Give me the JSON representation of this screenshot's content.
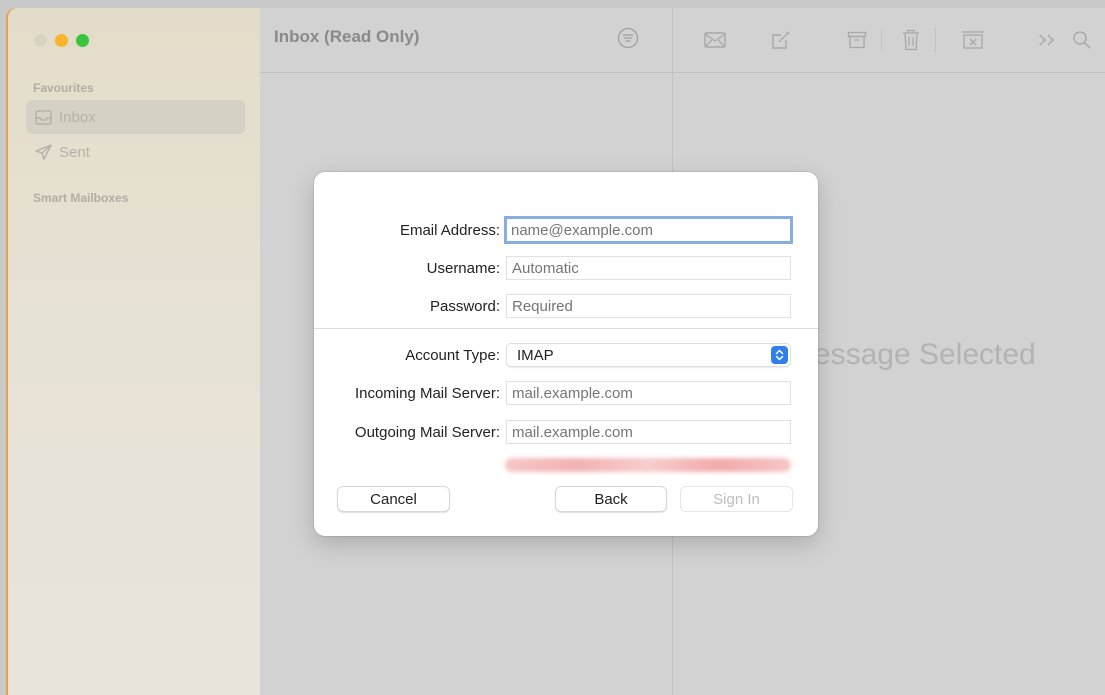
{
  "sidebar": {
    "favourites_header": "Favourites",
    "items": [
      {
        "label": "Inbox",
        "icon": "inbox-icon",
        "selected": true
      },
      {
        "label": "Sent",
        "icon": "paper-plane-icon",
        "selected": false
      }
    ],
    "smart_mailboxes_header": "Smart Mailboxes"
  },
  "list": {
    "title": "Inbox (Read Only)",
    "filter_icon": "filter-icon"
  },
  "toolbar": {
    "icons": [
      "envelope-icon",
      "compose-icon",
      "archive-icon",
      "trash-icon",
      "junk-icon",
      "more-chevron-icon",
      "search-icon"
    ]
  },
  "message_view": {
    "empty_text": "No Message Selected"
  },
  "dialog": {
    "email": {
      "label": "Email Address:",
      "placeholder": "name@example.com"
    },
    "username": {
      "label": "Username:",
      "placeholder": "Automatic"
    },
    "password": {
      "label": "Password:",
      "placeholder": "Required"
    },
    "account_type": {
      "label": "Account Type:",
      "value": "IMAP"
    },
    "incoming": {
      "label": "Incoming Mail Server:",
      "placeholder": "mail.example.com"
    },
    "outgoing": {
      "label": "Outgoing Mail Server:",
      "placeholder": "mail.example.com"
    },
    "buttons": {
      "cancel": "Cancel",
      "back": "Back",
      "sign_in": "Sign In"
    }
  },
  "colors": {
    "accent": "#2f80ed",
    "focus_ring": "#86aee0",
    "traffic_min": "#f7b52c",
    "traffic_max": "#3bc53f"
  }
}
